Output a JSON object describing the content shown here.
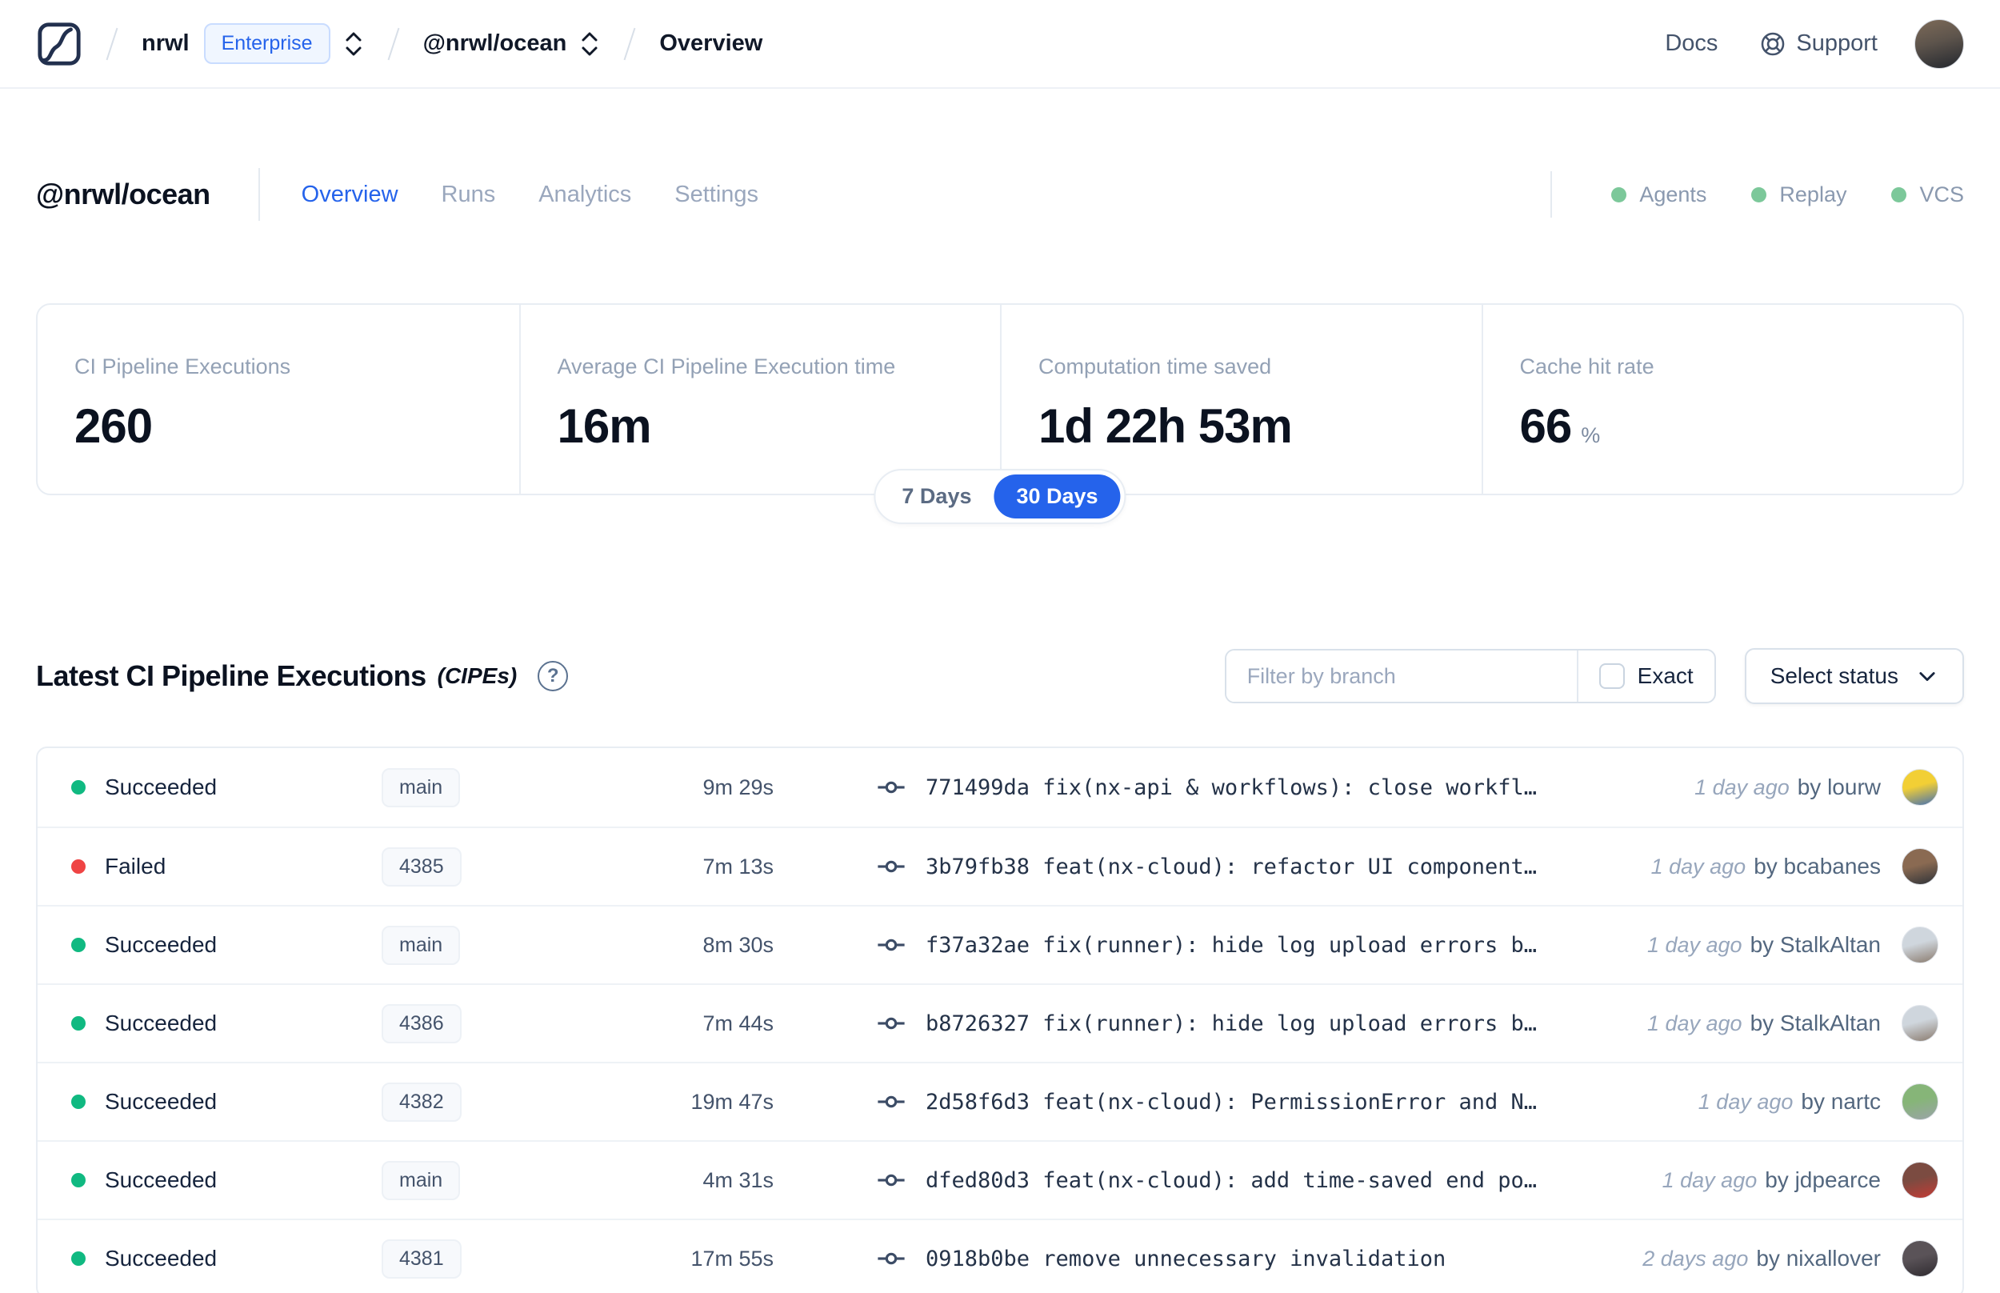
{
  "colors": {
    "accent": "#2563eb",
    "succeeded_dot": "#10b981",
    "failed_dot": "#ef4444",
    "feature_dot": "#7cc89a"
  },
  "navbar": {
    "org": "nrwl",
    "org_badge": "Enterprise",
    "workspace": "@nrwl/ocean",
    "page": "Overview",
    "docs_label": "Docs",
    "support_label": "Support"
  },
  "header": {
    "title": "@nrwl/ocean",
    "tabs": [
      {
        "label": "Overview",
        "active": true
      },
      {
        "label": "Runs",
        "active": false
      },
      {
        "label": "Analytics",
        "active": false
      },
      {
        "label": "Settings",
        "active": false
      }
    ],
    "features": [
      {
        "label": "Agents"
      },
      {
        "label": "Replay"
      },
      {
        "label": "VCS"
      }
    ]
  },
  "stats": {
    "cards": [
      {
        "label": "CI Pipeline Executions",
        "value": "260",
        "suffix": ""
      },
      {
        "label": "Average CI Pipeline Execution time",
        "value": "16m",
        "suffix": ""
      },
      {
        "label": "Computation time saved",
        "value": "1d 22h 53m",
        "suffix": ""
      },
      {
        "label": "Cache hit rate",
        "value": "66",
        "suffix": "%"
      }
    ],
    "range_toggle": {
      "options": [
        "7 Days",
        "30 Days"
      ],
      "selected": "30 Days"
    }
  },
  "cipe_section": {
    "title": "Latest CI Pipeline Executions",
    "title_suffix": "(CIPEs)",
    "help_glyph": "?",
    "filter_placeholder": "Filter by branch",
    "exact_label": "Exact",
    "status_button_label": "Select status"
  },
  "table": {
    "rows": [
      {
        "status": "Succeeded",
        "branch": "main",
        "duration": "9m 29s",
        "commit_hash": "771499da",
        "commit_message": "fix(nx-api & workflows): close workfl…",
        "time_ago": "1 day ago",
        "author": "by lourw",
        "avatar_colors": [
          "#f2cf35",
          "#4470b2"
        ]
      },
      {
        "status": "Failed",
        "branch": "4385",
        "duration": "7m 13s",
        "commit_hash": "3b79fb38",
        "commit_message": "feat(nx-cloud): refactor UI component…",
        "time_ago": "1 day ago",
        "author": "by bcabanes",
        "avatar_colors": [
          "#8a6a52",
          "#2e3238"
        ]
      },
      {
        "status": "Succeeded",
        "branch": "main",
        "duration": "8m 30s",
        "commit_hash": "f37a32ae",
        "commit_message": "fix(runner): hide log upload errors b…",
        "time_ago": "1 day ago",
        "author": "by StalkAltan",
        "avatar_colors": [
          "#cfd6dd",
          "#8a7b6e"
        ]
      },
      {
        "status": "Succeeded",
        "branch": "4386",
        "duration": "7m 44s",
        "commit_hash": "b8726327",
        "commit_message": "fix(runner): hide log upload errors b…",
        "time_ago": "1 day ago",
        "author": "by StalkAltan",
        "avatar_colors": [
          "#cfd6dd",
          "#8a7b6e"
        ]
      },
      {
        "status": "Succeeded",
        "branch": "4382",
        "duration": "19m 47s",
        "commit_hash": "2d58f6d3",
        "commit_message": "feat(nx-cloud): PermissionError and N…",
        "time_ago": "1 day ago",
        "author": "by nartc",
        "avatar_colors": [
          "#86b578",
          "#9aa3a8"
        ]
      },
      {
        "status": "Succeeded",
        "branch": "main",
        "duration": "4m 31s",
        "commit_hash": "dfed80d3",
        "commit_message": "feat(nx-cloud): add time-saved end po…",
        "time_ago": "1 day ago",
        "author": "by jdpearce",
        "avatar_colors": [
          "#7b4b41",
          "#c43b35"
        ]
      },
      {
        "status": "Succeeded",
        "branch": "4381",
        "duration": "17m 55s",
        "commit_hash": "0918b0be",
        "commit_message": "remove unnecessary invalidation",
        "time_ago": "2 days ago",
        "author": "by nixallover",
        "avatar_colors": [
          "#5a5358",
          "#2f2b30"
        ]
      }
    ]
  }
}
